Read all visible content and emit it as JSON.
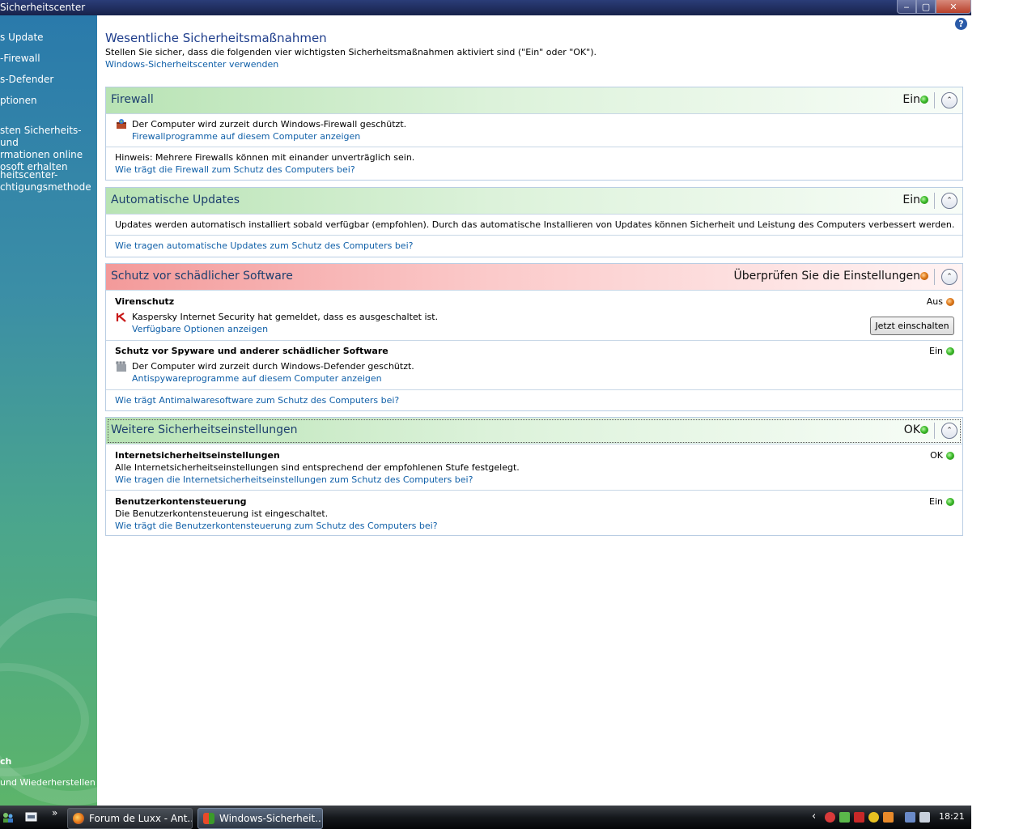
{
  "window": {
    "title": "Sicherheitscenter",
    "buttons": {
      "minimize": "‒",
      "maximize": "▢",
      "close": "✕"
    }
  },
  "sidebar": {
    "links": [
      "s Update",
      "-Firewall",
      "s-Defender",
      "ptionen",
      "sten Sicherheits- und\nrmationen online\nosoft erhalten",
      "heitscenter-\nchtigungsmethode"
    ],
    "bottom": [
      "ch",
      "und Wiederherstellen"
    ]
  },
  "main": {
    "help": "?",
    "title": "Wesentliche Sicherheitsmaßnahmen",
    "intro": "Stellen Sie sicher, dass die folgenden vier wichtigsten Sicherheitsmaßnahmen aktiviert sind (\"Ein\" oder \"OK\").",
    "intro_link": "Windows-Sicherheitscenter verwenden",
    "collapse_symbol": "⌃",
    "firewall": {
      "title": "Firewall",
      "status": "Ein",
      "text": "Der Computer wird zurzeit durch Windows-Firewall geschützt.",
      "link": "Firewallprogramme auf diesem Computer anzeigen",
      "hint": "Hinweis: Mehrere Firewalls können mit einander unverträglich sein.",
      "hint_link": "Wie trägt die Firewall zum Schutz des Computers bei?"
    },
    "updates": {
      "title": "Automatische Updates",
      "status": "Ein",
      "text": "Updates werden automatisch installiert sobald verfügbar (empfohlen). Durch das automatische Installieren von Updates können Sicherheit und Leistung des Computers verbessert werden.",
      "link": "Wie tragen automatische Updates zum Schutz des Computers bei?"
    },
    "malware": {
      "title": "Schutz vor schädlicher Software",
      "status": "Überprüfen Sie die Einstellungen",
      "virus": {
        "heading": "Virenschutz",
        "status": "Aus",
        "text": "Kaspersky Internet Security hat gemeldet, dass es ausgeschaltet ist.",
        "link": "Verfügbare Optionen anzeigen",
        "button": "Jetzt einschalten"
      },
      "spyware": {
        "heading": "Schutz vor Spyware und anderer schädlicher Software",
        "status": "Ein",
        "text": "Der Computer wird zurzeit durch Windows-Defender geschützt.",
        "link": "Antispywareprogramme auf diesem Computer anzeigen"
      },
      "link": "Wie trägt Antimalwaresoftware zum Schutz des Computers bei?"
    },
    "other": {
      "title": "Weitere Sicherheitseinstellungen",
      "status": "OK",
      "internet": {
        "heading": "Internetsicherheitseinstellungen",
        "status": "OK",
        "text": "Alle Internetsicherheitseinstellungen sind entsprechend der empfohlenen Stufe festgelegt.",
        "link": "Wie tragen die Internetsicherheitseinstellungen zum Schutz des Computers bei?"
      },
      "uac": {
        "heading": "Benutzerkontensteuerung",
        "status": "Ein",
        "text": "Die Benutzerkontensteuerung ist eingeschaltet.",
        "link": "Wie trägt die Benutzerkontensteuerung zum Schutz des Computers bei?"
      }
    }
  },
  "taskbar": {
    "chevron": "»",
    "tasks": [
      {
        "label": "Forum de Luxx - Ant...",
        "icon": "firefox-icon"
      },
      {
        "label": "Windows-Sicherheit...",
        "icon": "shield-icon"
      }
    ],
    "tray_chevron": "‹",
    "clock": "18:21"
  },
  "colors": {
    "link": "#0f5fa8",
    "heading": "#1f3e8c",
    "status_ok": "#3dbb2a",
    "status_warn": "#e07a1a"
  }
}
